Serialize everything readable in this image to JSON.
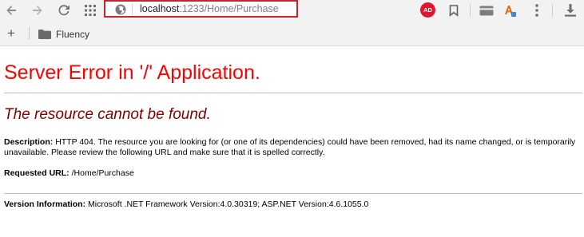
{
  "browser": {
    "url_host": "localhost",
    "url_rest": ":1233/Home/Purchase",
    "adblock_label": "AD"
  },
  "bookmarks": {
    "folder_label": "Fluency"
  },
  "error_page": {
    "title": "Server Error in '/' Application.",
    "subtitle": "The resource cannot be found.",
    "description_label": "Description:",
    "description_text": "HTTP 404. The resource you are looking for (or one of its dependencies) could have been removed, had its name changed, or is temporarily unavailable.  Please review the following URL and make sure that it is spelled correctly.",
    "requested_url_label": "Requested URL:",
    "requested_url_value": "/Home/Purchase",
    "version_label": "Version Information:",
    "version_value": "Microsoft .NET Framework Version:4.0.30319; ASP.NET Version:4.6.1055.0"
  }
}
